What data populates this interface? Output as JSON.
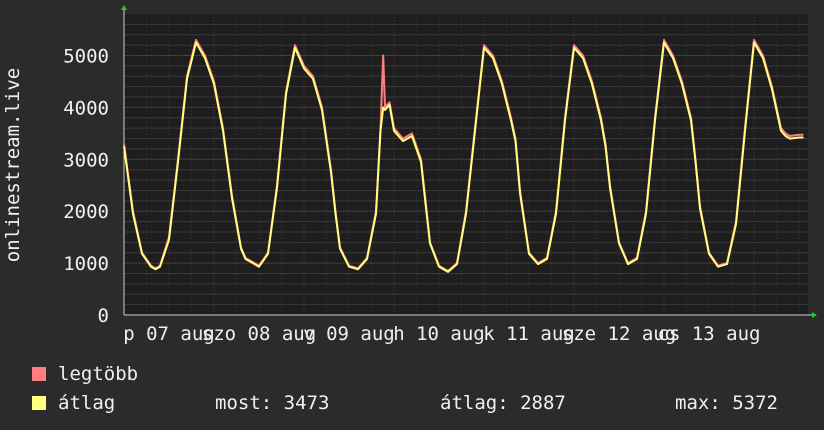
{
  "chart_data": {
    "type": "line",
    "ylabel": "onlinestream.live",
    "ylim": [
      0,
      5800
    ],
    "yticks": [
      0,
      1000,
      2000,
      3000,
      4000,
      5000
    ],
    "x_tick_labels": [
      "p 07 aug",
      "szo 08 aug",
      "v 09 aug",
      "h 10 aug",
      "k 11 aug",
      "sze 12 aug",
      "cs 13 aug"
    ],
    "x_range_days": [
      0,
      7.6
    ],
    "grid": true,
    "series": [
      {
        "name": "legtöbb",
        "color": "#ff7f7f",
        "x": [
          0,
          0.1,
          0.2,
          0.3,
          0.35,
          0.4,
          0.5,
          0.6,
          0.7,
          0.8,
          0.9,
          1.0,
          1.1,
          1.2,
          1.3,
          1.35,
          1.4,
          1.5,
          1.6,
          1.7,
          1.8,
          1.9,
          2.0,
          2.1,
          2.2,
          2.3,
          2.35,
          2.4,
          2.5,
          2.6,
          2.7,
          2.8,
          2.85,
          2.88,
          2.9,
          2.95,
          3.0,
          3.1,
          3.2,
          3.3,
          3.35,
          3.4,
          3.5,
          3.6,
          3.7,
          3.8,
          3.9,
          4.0,
          4.1,
          4.2,
          4.3,
          4.35,
          4.4,
          4.5,
          4.6,
          4.7,
          4.8,
          4.9,
          5.0,
          5.1,
          5.2,
          5.3,
          5.35,
          5.4,
          5.5,
          5.6,
          5.7,
          5.8,
          5.9,
          6.0,
          6.1,
          6.2,
          6.3,
          6.35,
          6.4,
          6.5,
          6.6,
          6.7,
          6.8,
          6.9,
          7.0,
          7.1,
          7.2,
          7.3,
          7.35,
          7.4,
          7.5,
          7.55
        ],
        "values": [
          3300,
          2000,
          1200,
          950,
          900,
          950,
          1500,
          3000,
          4600,
          5300,
          5000,
          4500,
          3600,
          2300,
          1300,
          1100,
          1050,
          950,
          1200,
          2500,
          4300,
          5200,
          4800,
          4600,
          4000,
          2800,
          2000,
          1300,
          950,
          900,
          1100,
          2000,
          3600,
          5000,
          4000,
          4100,
          3600,
          3400,
          3500,
          3000,
          2200,
          1400,
          950,
          850,
          1000,
          2000,
          3600,
          5200,
          5000,
          4500,
          3800,
          3400,
          2400,
          1200,
          1000,
          1100,
          2000,
          3800,
          5200,
          5000,
          4500,
          3800,
          3300,
          2500,
          1400,
          1000,
          1100,
          2000,
          3800,
          5300,
          5000,
          4500,
          3800,
          3000,
          2100,
          1200,
          950,
          1000,
          1800,
          3600,
          5300,
          5000,
          4400,
          3600,
          3500,
          3450,
          3473,
          3473
        ]
      },
      {
        "name": "átlag",
        "color": "#ffff80",
        "x": [
          0,
          0.1,
          0.2,
          0.3,
          0.35,
          0.4,
          0.5,
          0.6,
          0.7,
          0.8,
          0.9,
          1.0,
          1.1,
          1.2,
          1.3,
          1.35,
          1.4,
          1.5,
          1.6,
          1.7,
          1.8,
          1.9,
          2.0,
          2.1,
          2.2,
          2.3,
          2.35,
          2.4,
          2.5,
          2.6,
          2.7,
          2.8,
          2.85,
          2.88,
          2.9,
          2.95,
          3.0,
          3.1,
          3.2,
          3.3,
          3.35,
          3.4,
          3.5,
          3.6,
          3.7,
          3.8,
          3.9,
          4.0,
          4.1,
          4.2,
          4.3,
          4.35,
          4.4,
          4.5,
          4.6,
          4.7,
          4.8,
          4.9,
          5.0,
          5.1,
          5.2,
          5.3,
          5.35,
          5.4,
          5.5,
          5.6,
          5.7,
          5.8,
          5.9,
          6.0,
          6.1,
          6.2,
          6.3,
          6.35,
          6.4,
          6.5,
          6.6,
          6.7,
          6.8,
          6.9,
          7.0,
          7.1,
          7.2,
          7.3,
          7.35,
          7.4,
          7.5,
          7.55
        ],
        "values": [
          3250,
          1950,
          1180,
          930,
          880,
          930,
          1450,
          2950,
          4550,
          5250,
          4950,
          4450,
          3550,
          2250,
          1280,
          1080,
          1030,
          930,
          1180,
          2450,
          4250,
          5150,
          4750,
          4550,
          3950,
          2750,
          1950,
          1280,
          930,
          880,
          1080,
          1950,
          3550,
          4000,
          3950,
          4050,
          3550,
          3350,
          3450,
          2950,
          2150,
          1380,
          930,
          830,
          980,
          1950,
          3550,
          5150,
          4950,
          4450,
          3750,
          3350,
          2350,
          1180,
          980,
          1080,
          1950,
          3750,
          5150,
          4950,
          4450,
          3750,
          3250,
          2450,
          1380,
          980,
          1080,
          1950,
          3750,
          5250,
          4950,
          4450,
          3750,
          2950,
          2050,
          1180,
          930,
          980,
          1750,
          3550,
          5250,
          4950,
          4350,
          3550,
          3450,
          3400,
          3420,
          3420
        ]
      }
    ]
  },
  "legend": {
    "max_label": "legtöbb",
    "avg_label": "átlag",
    "max_color": "#ff7f7f",
    "avg_color": "#ffff80"
  },
  "stats": {
    "now": "most: 3473",
    "avg": "átlag: 2887",
    "max": "max: 5372"
  }
}
